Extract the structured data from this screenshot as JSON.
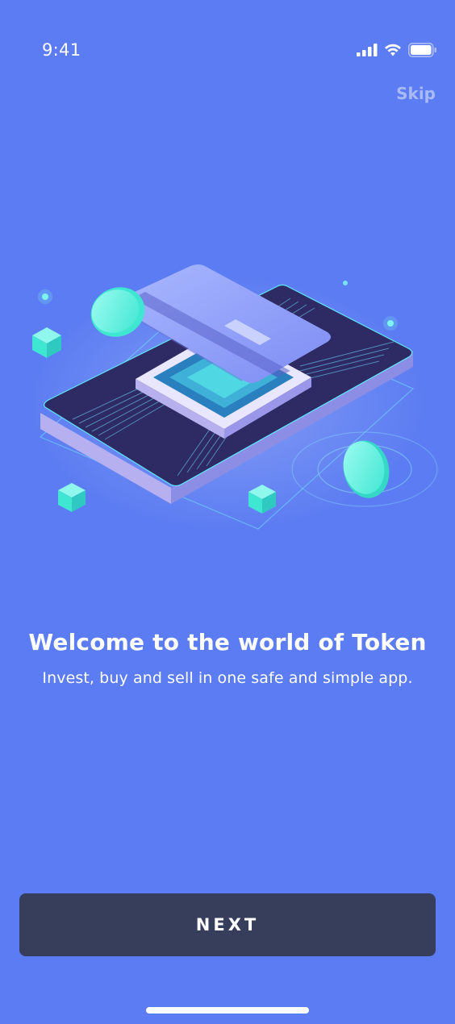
{
  "status_bar": {
    "time": "9:41",
    "icons": [
      "signal-icon",
      "wifi-icon",
      "battery-icon"
    ]
  },
  "header": {
    "skip_label": "Skip"
  },
  "onboarding": {
    "illustration": "phone-card-chip-illustration",
    "title": "Welcome to the world of Token",
    "subtitle": "Invest, buy and sell in one safe and simple app."
  },
  "footer": {
    "next_label": "NEXT"
  },
  "colors": {
    "background": "#5b7cf2",
    "button": "#373e5c",
    "accent_teal": "#54f0dc",
    "skip_text": "#a9bbf6"
  }
}
